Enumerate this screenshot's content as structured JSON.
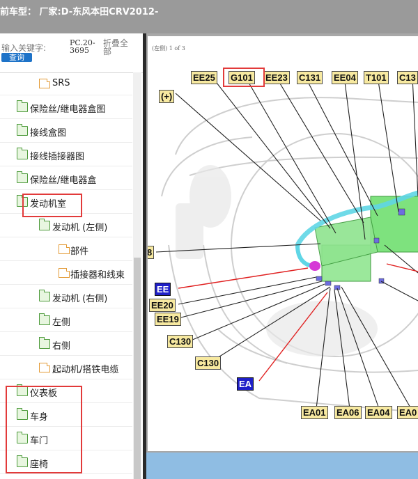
{
  "window": {
    "title": "前车型：  厂家:D-东风本田CRV2012-"
  },
  "sidebar": {
    "search_label": "输入关键字:",
    "query_button": "查询",
    "pc_code": "PC.20-3695",
    "collapse_all": "折叠全部",
    "items": [
      {
        "label": "SRS",
        "type": "file"
      },
      {
        "label": "保险丝/继电器盒图",
        "type": "folder"
      },
      {
        "label": "接线盒图",
        "type": "folder"
      },
      {
        "label": "接线插接器图",
        "type": "folder"
      },
      {
        "label": "保险丝/继电器盒",
        "type": "folder"
      },
      {
        "label": "发动机室",
        "type": "folder-open"
      },
      {
        "label": "发动机 (左侧)",
        "type": "folder-open"
      },
      {
        "label": "部件",
        "type": "file"
      },
      {
        "label": "插接器和线束",
        "type": "file"
      },
      {
        "label": "发动机 (右侧)",
        "type": "folder"
      },
      {
        "label": "左侧",
        "type": "folder"
      },
      {
        "label": "右侧",
        "type": "folder"
      },
      {
        "label": "起动机/搭铁电缆",
        "type": "file"
      },
      {
        "label": "仪表板",
        "type": "folder"
      },
      {
        "label": "车身",
        "type": "folder"
      },
      {
        "label": "车门",
        "type": "folder"
      },
      {
        "label": "座椅",
        "type": "folder-open"
      }
    ]
  },
  "diagram": {
    "header": "(左侧)  1 of 3",
    "labels": {
      "plus": "(+)",
      "ee25": "EE25",
      "g101": "G101",
      "ee23": "EE23",
      "c131": "C131",
      "ee04": "EE04",
      "t101": "T101",
      "c13x": "C13",
      "num8": "8",
      "ee": "EE",
      "ee20": "EE20",
      "ee19": "EE19",
      "c130a": "C130",
      "c130b": "C130",
      "ea": "EA",
      "ea01": "EA01",
      "ea06": "EA06",
      "ea04": "EA04",
      "ea0x": "EA0"
    }
  },
  "colors": {
    "highlight": "#e23a3a",
    "battery": "#7ee27e",
    "label_fill": "#f7e9a0",
    "label_blue": "#1f1fc8"
  }
}
